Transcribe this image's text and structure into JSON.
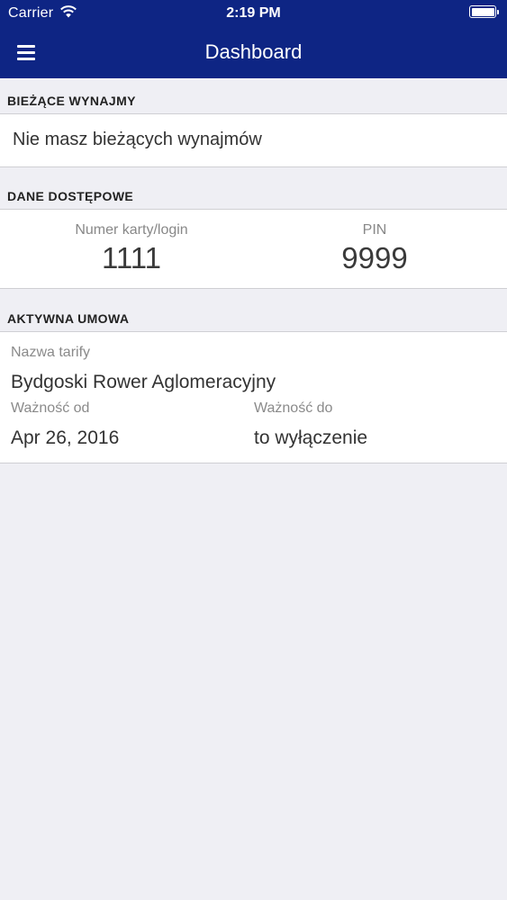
{
  "status_bar": {
    "carrier": "Carrier",
    "time": "2:19 PM",
    "wifi_icon": "wifi-icon",
    "battery_level": 1.0
  },
  "nav": {
    "title": "Dashboard",
    "menu_icon": "hamburger-menu-icon"
  },
  "current_rentals": {
    "header": "BIEŻĄCE WYNAJMY",
    "empty_message": "Nie masz bieżących wynajmów"
  },
  "access_data": {
    "header": "DANE DOSTĘPOWE",
    "card_label": "Numer karty/login",
    "card_value": "1111",
    "pin_label": "PIN",
    "pin_value": "9999"
  },
  "active_contract": {
    "header": "AKTYWNA UMOWA",
    "tariff_label": "Nazwa tarify",
    "tariff_value": "Bydgoski Rower Aglomeracyjny",
    "valid_from_label": "Ważność od",
    "valid_from_value": "Apr 26, 2016",
    "valid_to_label": "Ważność do",
    "valid_to_value": "to wyłączenie"
  },
  "colors": {
    "nav_background": "#0e2584",
    "page_background": "#efeff4"
  }
}
